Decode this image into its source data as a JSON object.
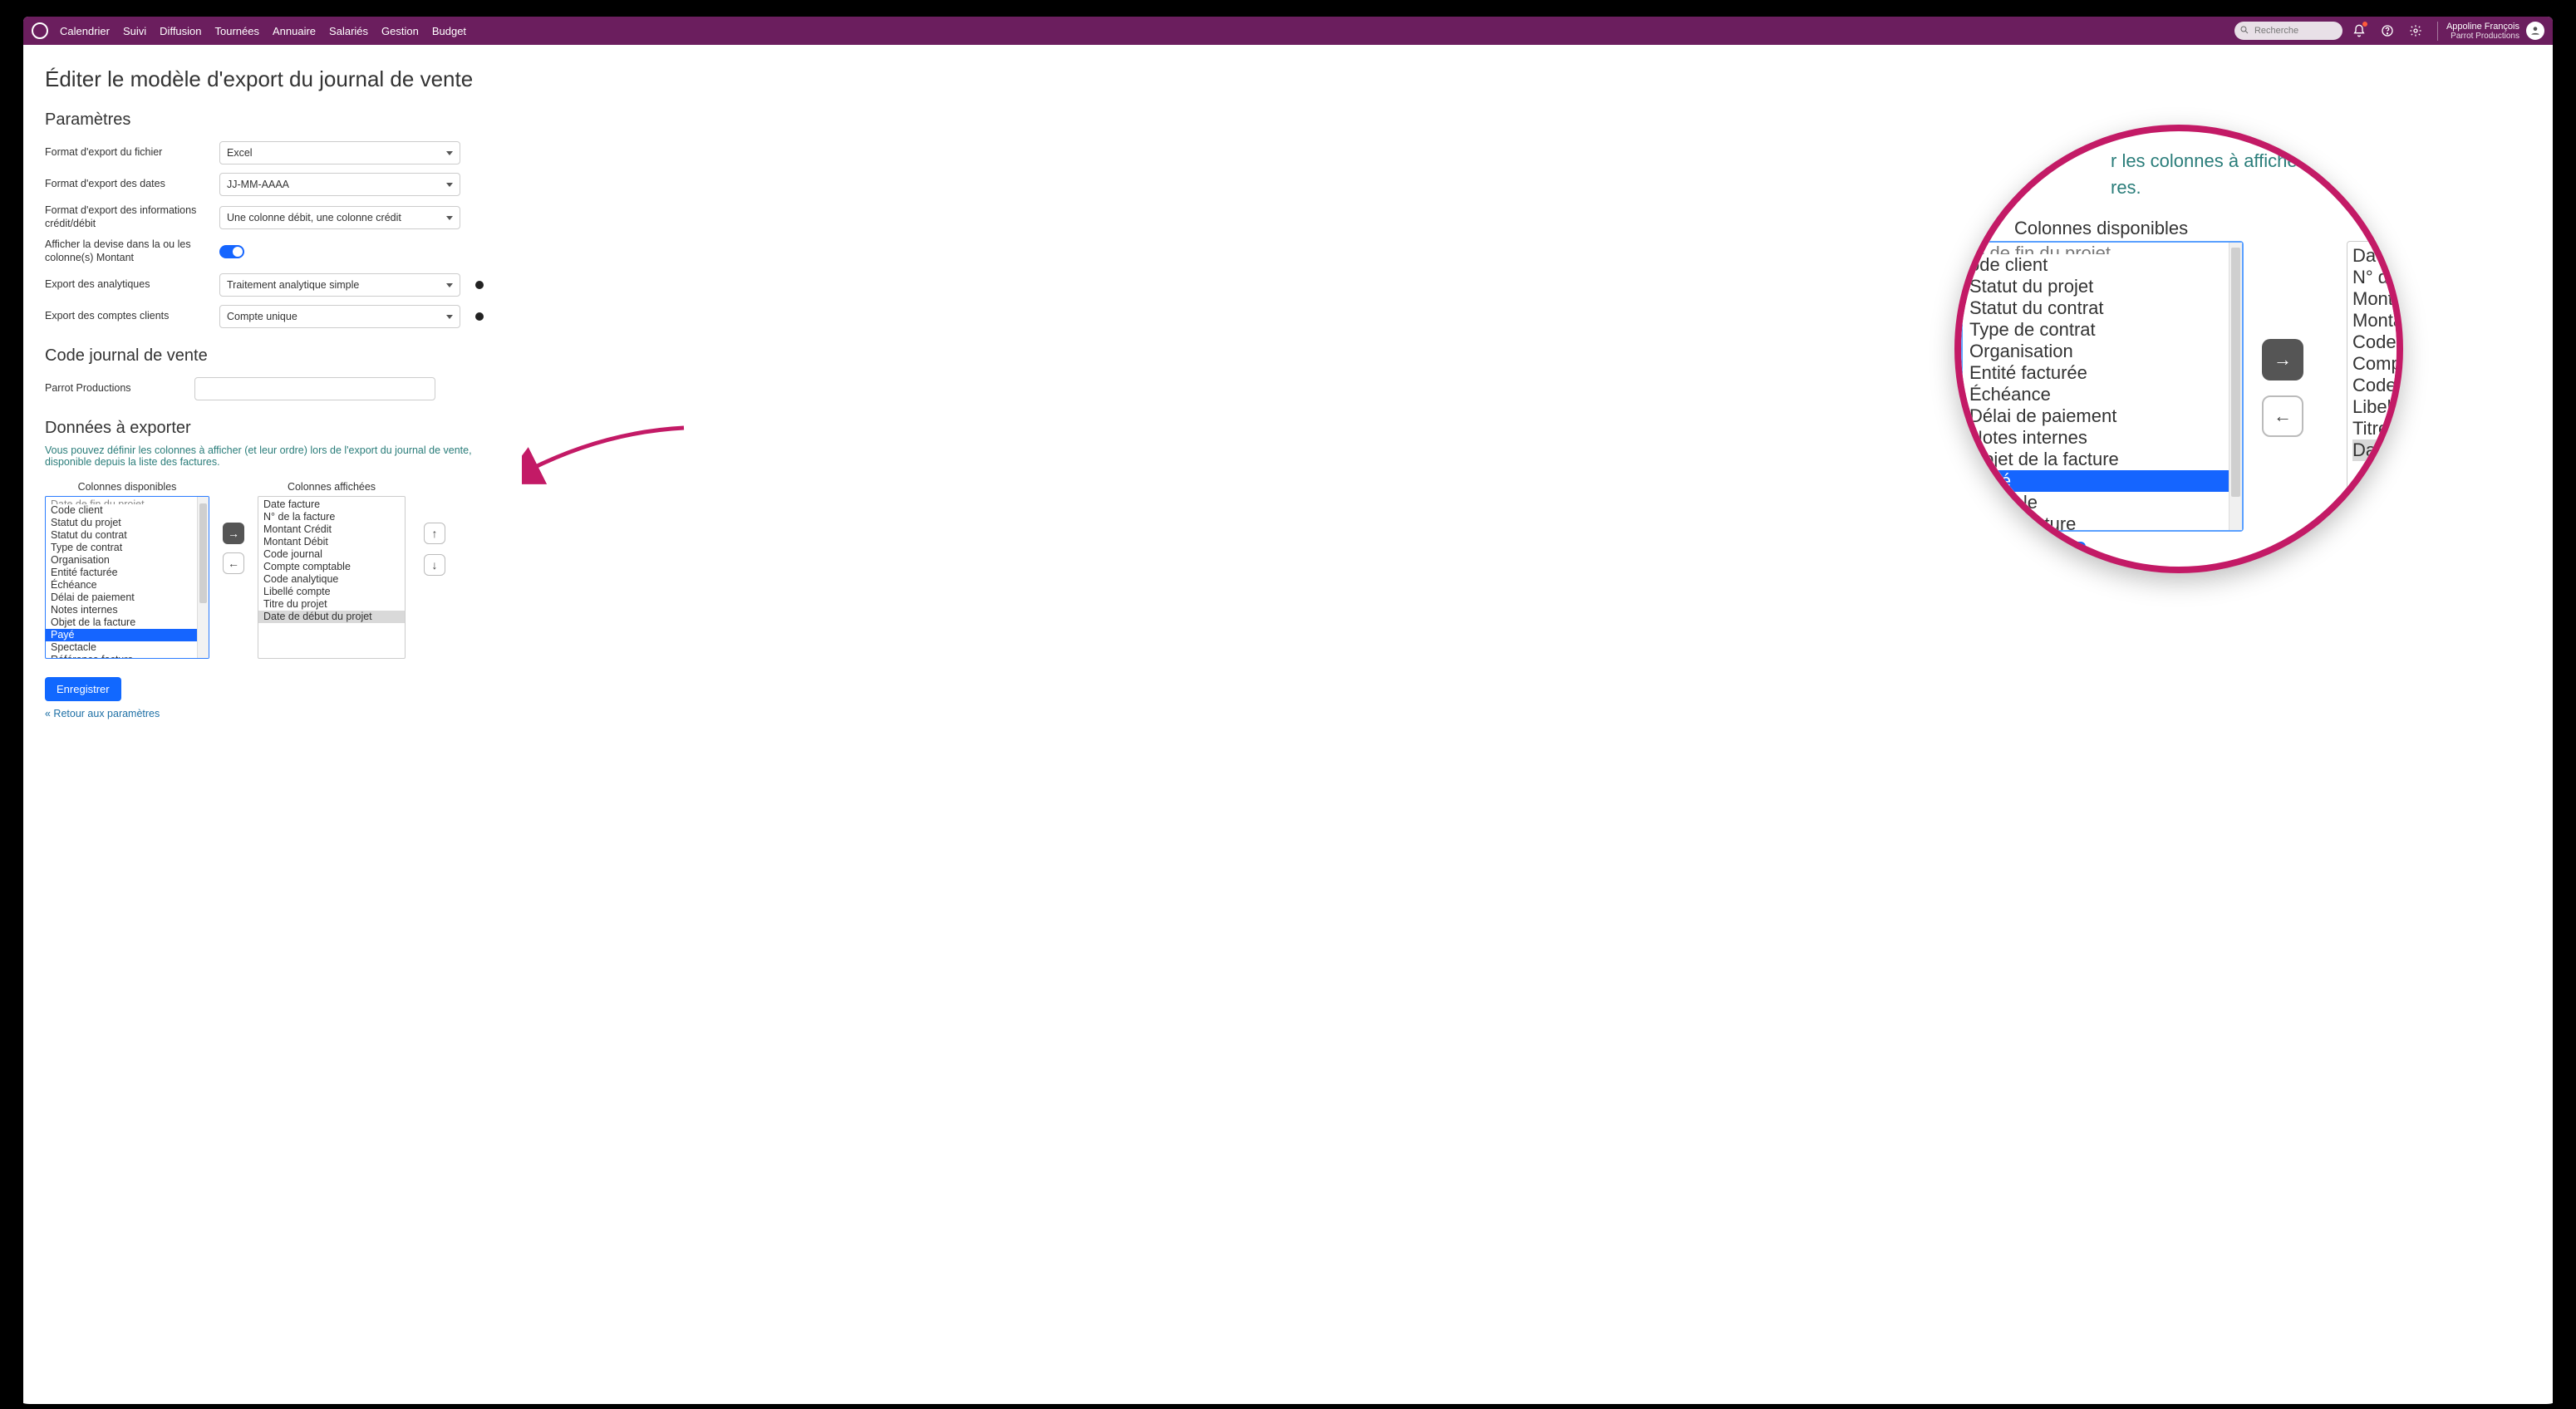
{
  "brand_color": "#6b1e5e",
  "accent_blue": "#1565ff",
  "pink_ring": "#c31a66",
  "nav": {
    "items": [
      "Calendrier",
      "Suivi",
      "Diffusion",
      "Tournées",
      "Annuaire",
      "Salariés",
      "Gestion",
      "Budget"
    ],
    "search_placeholder": "Recherche"
  },
  "user": {
    "name": "Appoline François",
    "org": "Parrot Productions"
  },
  "page": {
    "title": "Éditer le modèle d'export du journal de vente",
    "params_heading": "Paramètres",
    "params": {
      "file_format_label": "Format d'export du fichier",
      "file_format_value": "Excel",
      "date_format_label": "Format d'export des dates",
      "date_format_value": "JJ-MM-AAAA",
      "credit_debit_label": "Format d'export des informations crédit/débit",
      "credit_debit_value": "Une colonne débit, une colonne crédit",
      "show_currency_label": "Afficher la devise dans la ou les colonne(s) Montant",
      "analytics_label": "Export des analytiques",
      "analytics_value": "Traitement analytique simple",
      "client_accounts_label": "Export des comptes clients",
      "client_accounts_value": "Compte unique"
    },
    "code_heading": "Code journal de vente",
    "code_label": "Parrot Productions",
    "data_heading": "Données à exporter",
    "help_text": "Vous pouvez définir les colonnes à afficher (et leur ordre) lors de l'export du journal de vente, disponible depuis la liste des factures.",
    "col_available_title": "Colonnes disponibles",
    "col_shown_title": "Colonnes affichées",
    "available_clipped": "Date de fin du projet",
    "available": [
      "Code client",
      "Statut du projet",
      "Statut du contrat",
      "Type de contrat",
      "Organisation",
      "Entité facturée",
      "Échéance",
      "Délai de paiement",
      "Notes internes",
      "Objet de la facture",
      "Payé",
      "Spectacle",
      "Référence facture"
    ],
    "available_selected_index": 10,
    "shown": [
      "Date facture",
      "N° de la facture",
      "Montant Crédit",
      "Montant Débit",
      "Code journal",
      "Compte comptable",
      "Code analytique",
      "Libellé compte",
      "Titre du projet",
      "Date de début du projet"
    ],
    "shown_hl_index": 9,
    "save_label": "Enregistrer",
    "back_label": "« Retour aux paramètres"
  },
  "magnifier": {
    "help_frag_1": "r les colonnes à afficher (et leu",
    "help_frag_2": "res.",
    "col_title": "Colonnes disponibles",
    "clipped_top": "te de fin du projet",
    "items": [
      "ode client",
      "Statut du projet",
      "Statut du contrat",
      "Type de contrat",
      "Organisation",
      "Entité facturée",
      "Échéance",
      "Délai de paiement",
      "Notes internes",
      "Objet de la facture",
      "Payé",
      "pectacle",
      "rence facture"
    ],
    "selected_index": 10,
    "right_items": [
      "Da",
      "N° d",
      "Mont",
      "Monta",
      "Code j",
      "Compt",
      "Code a",
      "Libelle",
      "Titre",
      "Date"
    ],
    "right_hl_index": 9
  }
}
